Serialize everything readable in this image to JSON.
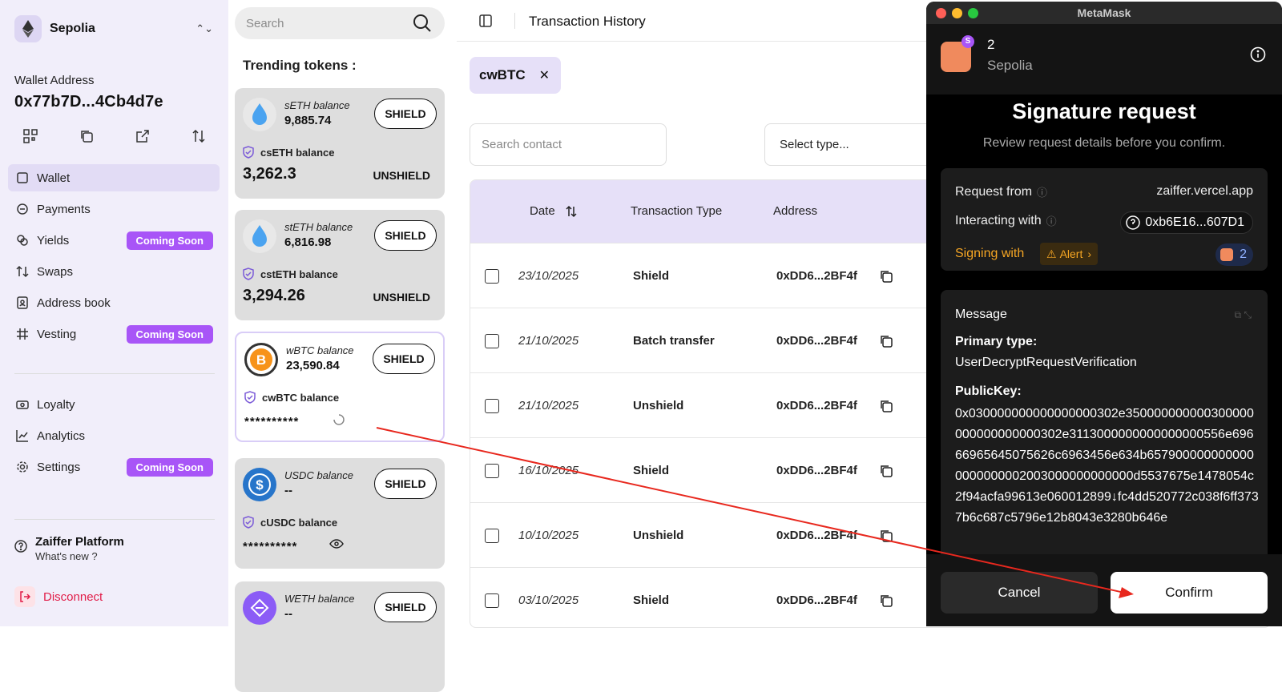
{
  "sidebar": {
    "network": "Sepolia",
    "wallet_label": "Wallet Address",
    "wallet_address": "0x77b7D...4Cb4d7e",
    "nav": [
      {
        "label": "Wallet",
        "icon": "wallet-icon",
        "active": true
      },
      {
        "label": "Payments",
        "icon": "payments-icon"
      },
      {
        "label": "Yields",
        "icon": "yields-icon",
        "badge": "Coming Soon"
      },
      {
        "label": "Swaps",
        "icon": "swap-icon"
      },
      {
        "label": "Address book",
        "icon": "address-book-icon"
      },
      {
        "label": "Vesting",
        "icon": "vesting-icon",
        "badge": "Coming Soon"
      },
      {
        "label": "Loyalty",
        "icon": "loyalty-icon"
      },
      {
        "label": "Analytics",
        "icon": "analytics-icon"
      },
      {
        "label": "Settings",
        "icon": "gear-icon",
        "badge": "Coming Soon"
      }
    ],
    "platform_title": "Zaiffer Platform",
    "platform_sub": "What's new ?",
    "disconnect": "Disconnect"
  },
  "tokens": {
    "search_placeholder": "Search",
    "heading": "Trending tokens :",
    "cards": [
      {
        "label": "sETH balance",
        "value": "9,885.74",
        "shield": "SHIELD",
        "c_label": "csETH balance",
        "c_value": "3,262.3",
        "unshield": "UNSHIELD"
      },
      {
        "label": "stETH balance",
        "value": "6,816.98",
        "shield": "SHIELD",
        "c_label": "cstETH balance",
        "c_value": "3,294.26",
        "unshield": "UNSHIELD"
      },
      {
        "label": "wBTC balance",
        "value": "23,590.84",
        "shield": "SHIELD",
        "c_label": "cwBTC balance",
        "c_mask": "**********"
      },
      {
        "label": "USDC balance",
        "value": "--",
        "shield": "SHIELD",
        "c_label": "cUSDC balance",
        "c_mask": "**********"
      },
      {
        "label": "WETH balance",
        "value": "--",
        "shield": "SHIELD"
      }
    ]
  },
  "main": {
    "title": "Transaction History",
    "filter_chip": "cwBTC",
    "search_contact": "Search contact",
    "select_type": "Select type...",
    "columns": [
      "Date",
      "Transaction Type",
      "Address"
    ],
    "rows": [
      {
        "date": "23/10/2025",
        "type": "Shield",
        "address": "0xDD6...2BF4f"
      },
      {
        "date": "21/10/2025",
        "type": "Batch transfer",
        "address": "0xDD6...2BF4f"
      },
      {
        "date": "21/10/2025",
        "type": "Unshield",
        "address": "0xDD6...2BF4f"
      },
      {
        "date": "16/10/2025",
        "type": "Shield",
        "address": "0xDD6...2BF4f"
      },
      {
        "date": "10/10/2025",
        "type": "Unshield",
        "address": "0xDD6...2BF4f"
      },
      {
        "date": "03/10/2025",
        "type": "Shield",
        "address": "0xDD6...2BF4f"
      }
    ]
  },
  "metamask": {
    "window_title": "MetaMask",
    "account": "2",
    "network": "Sepolia",
    "heading": "Signature request",
    "subheading": "Review request details before you confirm.",
    "request_from_label": "Request from",
    "request_from_value": "zaiffer.vercel.app",
    "interacting_label": "Interacting with",
    "interacting_value": "0xb6E16...607D1",
    "signing_label": "Signing with",
    "alert_label": "Alert",
    "signing_account": "2",
    "message_label": "Message",
    "primary_type_label": "Primary type:",
    "primary_type_value": "UserDecryptRequestVerification",
    "public_key_label": "PublicKey:",
    "public_key_value": "0x030000000000000000302e350000000000300000000000000000302e3113000000000000000556e69666965645075626c6963456e634b6579000000000000000000002003000000000000d5537675e1478054c2f94acfa99613e060012899↓fc4dd520772c038f6ff3737b6c687c5796e12b8043e3280b646e",
    "cancel": "Cancel",
    "confirm": "Confirm"
  },
  "colors": {
    "accent": "#a855f7",
    "chip_bg": "#e6e0f8",
    "warning": "#f6a623",
    "danger": "#e11d48"
  }
}
